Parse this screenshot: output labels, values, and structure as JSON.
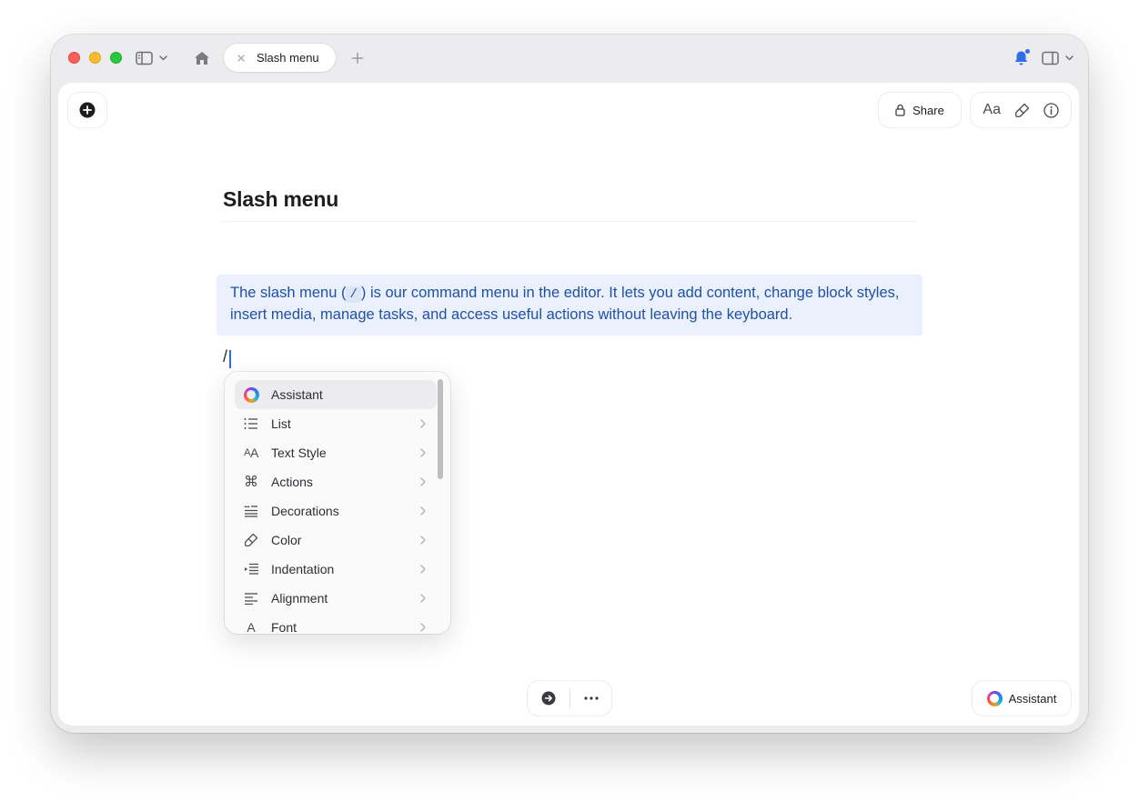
{
  "titlebar": {
    "tab_title": "Slash menu",
    "icons": [
      "sidebar-toggle-icon",
      "home-icon",
      "close-icon",
      "plus-icon",
      "bell-icon",
      "panel-toggle-icon"
    ]
  },
  "toolbar": {
    "share_label": "Share",
    "text_format_label": "Aa"
  },
  "document": {
    "title": "Slash menu",
    "callout_before": "The slash menu (",
    "callout_key": "/",
    "callout_after": ") is our command menu in the editor. It lets you add content, change block styles, insert media, manage tasks, and access useful actions without leaving the keyboard.",
    "current_line": "/"
  },
  "slash_menu": {
    "items": [
      {
        "label": "Assistant",
        "icon": "assistant-icon",
        "has_submenu": false,
        "active": true
      },
      {
        "label": "List",
        "icon": "list-icon",
        "has_submenu": true
      },
      {
        "label": "Text Style",
        "icon": "text-style-icon",
        "has_submenu": true
      },
      {
        "label": "Actions",
        "icon": "command-icon",
        "has_submenu": true
      },
      {
        "label": "Decorations",
        "icon": "decorations-icon",
        "has_submenu": true
      },
      {
        "label": "Color",
        "icon": "color-icon",
        "has_submenu": true
      },
      {
        "label": "Indentation",
        "icon": "indentation-icon",
        "has_submenu": true
      },
      {
        "label": "Alignment",
        "icon": "alignment-icon",
        "has_submenu": true
      },
      {
        "label": "Font",
        "icon": "font-icon",
        "has_submenu": true
      }
    ]
  },
  "footer": {
    "assistant_label": "Assistant"
  },
  "colors": {
    "callout_bg": "#eaf1fd",
    "callout_text": "#2150a6",
    "caret": "#2c6fdc",
    "notification_dot": "#2e6ee8"
  }
}
